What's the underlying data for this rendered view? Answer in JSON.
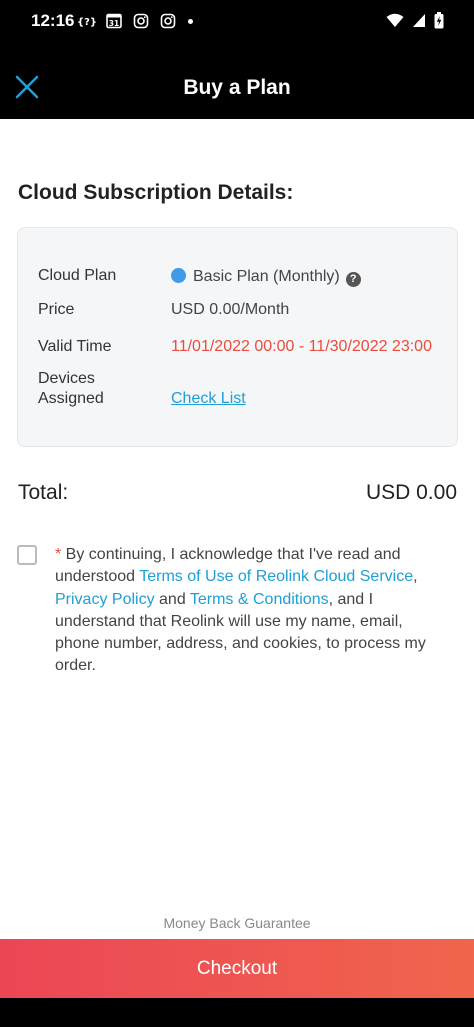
{
  "status_bar": {
    "time": "12:16",
    "icons": [
      "bracket-icon",
      "calendar-icon",
      "instagram-icon",
      "instagram-icon",
      "dot-icon",
      "wifi-icon",
      "cellular-icon",
      "battery-icon"
    ],
    "calendar_day": "31"
  },
  "header": {
    "title": "Buy a Plan",
    "close_icon": "close-icon",
    "accent": "#1e9fd6"
  },
  "section": {
    "title": "Cloud Subscription Details:"
  },
  "details": {
    "cloud_plan_label": "Cloud Plan",
    "cloud_plan_value": "Basic Plan (Monthly)",
    "plan_dot_color": "#3f9be8",
    "price_label": "Price",
    "price_value": "USD 0.00/Month",
    "valid_time_label": "Valid Time",
    "valid_time_value": "11/01/2022 00:00 - 11/30/2022 23:00",
    "devices_label_line1": "Devices",
    "devices_label_line2": "Assigned",
    "devices_link": "Check List"
  },
  "total": {
    "label": "Total:",
    "value": "USD 0.00"
  },
  "agreement": {
    "required_mark": "*",
    "text1": " By continuing, I acknowledge that I've read and understood ",
    "link1": "Terms of Use of Reolink Cloud Service",
    "text2": ", ",
    "link2": "Privacy Policy",
    "text3": " and ",
    "link3": "Terms & Conditions",
    "text4": ", and I understand that Reolink will use my name, email, phone number, address, and cookies, to process my order."
  },
  "footer": {
    "money_back": "Money Back Guarantee",
    "checkout_label": "Checkout"
  }
}
